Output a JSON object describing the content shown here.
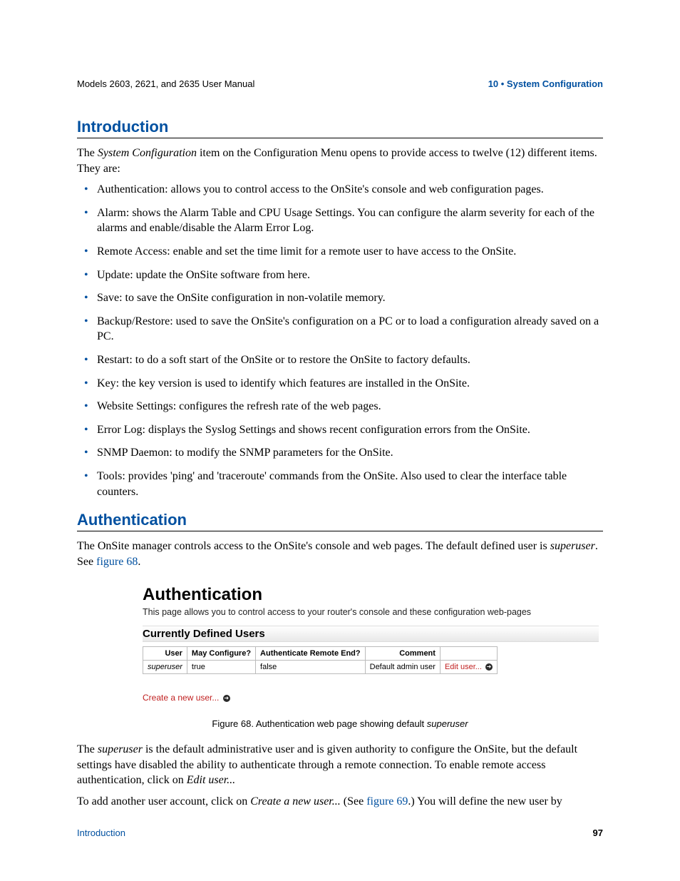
{
  "header": {
    "left": "Models 2603, 2621, and 2635 User Manual",
    "right": "10 • System Configuration"
  },
  "intro": {
    "heading": "Introduction",
    "para_prefix": "The ",
    "para_em": "System Configuration",
    "para_suffix": " item on the Configuration Menu opens to provide access to twelve (12) different items. They are:",
    "bullets": [
      "Authentication: allows you to control access to the OnSite's console and web configuration pages.",
      "Alarm: shows the Alarm Table and CPU Usage Settings. You can configure the alarm severity for each of the alarms and enable/disable the Alarm Error Log.",
      "Remote Access: enable and set the time limit for a remote user to have access to the OnSite.",
      "Update: update the OnSite software from here.",
      "Save: to save the OnSite configuration in non-volatile memory.",
      "Backup/Restore: used to save the OnSite's configuration on a PC or to load a configuration already saved on a PC.",
      "Restart: to do a soft start of the OnSite or to restore the OnSite to factory defaults.",
      "Key: the key version is used to identify which features are installed in the OnSite.",
      "Website Settings: configures the refresh rate of the web pages.",
      "Error Log: displays the Syslog Settings and shows recent configuration errors from the OnSite.",
      "SNMP Daemon: to modify the SNMP parameters for the OnSite.",
      "Tools: provides 'ping' and 'traceroute' commands from the OnSite. Also used to clear the interface table counters."
    ]
  },
  "auth": {
    "heading": "Authentication",
    "p1_a": "The OnSite manager controls access to the OnSite's console and web pages. The default defined user is ",
    "p1_em": "superuser",
    "p1_b": ". See ",
    "p1_link": "figure 68",
    "p1_c": "."
  },
  "figure": {
    "title": "Authentication",
    "sub": "This page allows you to control access to your router's console and these configuration web-pages",
    "cdu": "Currently Defined Users",
    "cols": [
      "User",
      "May Configure?",
      "Authenticate Remote End?",
      "Comment",
      ""
    ],
    "row": {
      "user": "superuser",
      "may": "true",
      "auth": "false",
      "comment": "Default admin user",
      "edit": "Edit user..."
    },
    "newuser": "Create a new user...",
    "caption_a": "Figure 68. Authentication web page showing default ",
    "caption_em": "superuser"
  },
  "post": {
    "p2_a": "The ",
    "p2_em1": "superuser",
    "p2_b": " is the default administrative user and is given authority to configure the OnSite, but the default settings have disabled the ability to authenticate through a remote connection. To enable remote access authentication, click on ",
    "p2_em2": "Edit user...",
    "p3_a": "To add another user account, click on ",
    "p3_em": "Create a new user...",
    "p3_b": " (See ",
    "p3_link": "figure 69",
    "p3_c": ".) You will define the new user by"
  },
  "footer": {
    "left": "Introduction",
    "right": "97"
  }
}
